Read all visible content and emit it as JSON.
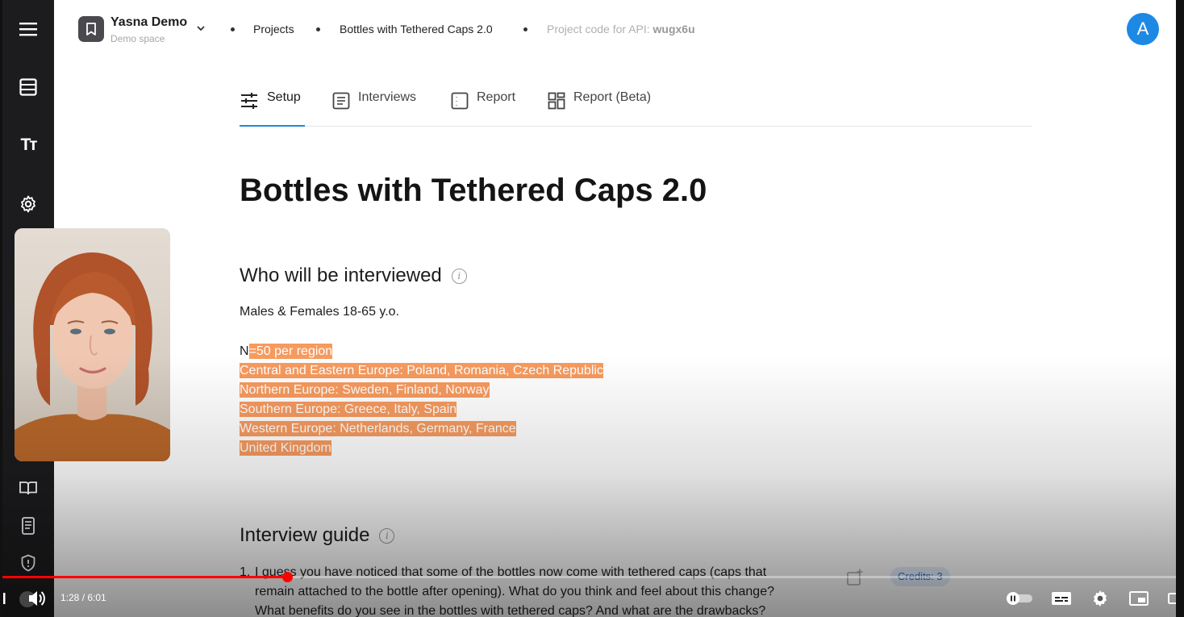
{
  "header": {
    "workspace_name": "Yasna Demo",
    "workspace_subtitle": "Demo space",
    "breadcrumb": [
      "Projects",
      "Bottles with Tethered Caps 2.0"
    ],
    "api_label": "Project code for API:",
    "api_code": "wugx6u",
    "avatar_letter": "A"
  },
  "sidebar": {
    "top_icons": [
      "menu-icon",
      "table-icon",
      "text-format-icon",
      "settings-icon"
    ],
    "bottom_icons": [
      "book-icon",
      "document-icon",
      "shield-icon"
    ]
  },
  "tabs": [
    {
      "label": "Setup",
      "icon": "sliders-icon",
      "active": true
    },
    {
      "label": "Interviews",
      "icon": "list-icon",
      "active": false
    },
    {
      "label": "Report",
      "icon": "report-icon",
      "active": false
    },
    {
      "label": "Report (Beta)",
      "icon": "grid-icon",
      "active": false
    }
  ],
  "page": {
    "title": "Bottles with Tethered Caps 2.0",
    "who_title": "Who will be interviewed",
    "who_line": "Males & Females 18-65 y.o.",
    "selected_first_char": "N",
    "selected_lines": [
      "=50 per region",
      "Central and Eastern Europe: Poland, Romania, Czech Republic",
      "Northern Europe: Sweden, Finland, Norway",
      "Southern Europe: Greece, Italy, Spain",
      "Western Europe: Netherlands, Germany, France",
      "United Kingdom"
    ],
    "selection_color": "#f79a5e",
    "guide_title": "Interview guide",
    "guide_items": [
      {
        "number": "1.",
        "lines": [
          "I guess you have noticed that some of the bottles now come with tethered caps (caps that",
          "remain attached to the bottle after opening). What do you think and feel about this change?",
          "What benefits do you see in the bottles with tethered caps? And what are the drawbacks?"
        ],
        "credits": "Credits: 3"
      }
    ]
  },
  "player": {
    "time": "1:28 / 6:01",
    "progress": 0.244,
    "accent": "#ff0000",
    "controls": [
      "volume-icon",
      "autoplay-toggle-icon",
      "subtitles-icon",
      "settings-icon",
      "miniplayer-icon",
      "theater-icon"
    ]
  },
  "colors": {
    "sidebar": "#1c1c1e",
    "accent": "#1e88e5"
  }
}
